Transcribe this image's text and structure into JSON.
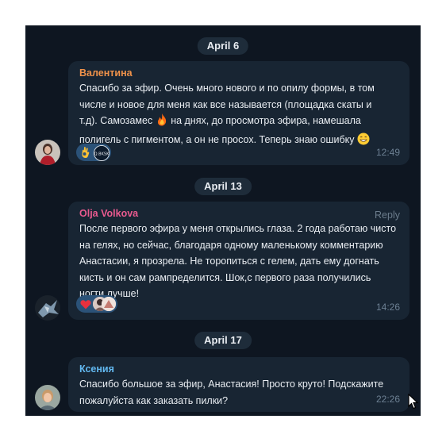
{
  "dates": [
    "April 6",
    "April 13",
    "April 17"
  ],
  "messages": [
    {
      "author": "Валентина",
      "author_color": "#f0924a",
      "text_lines": [
        "Спасибо за эфир. Очень много нового и по опилу формы, в том",
        "числе и новое для меня как все называется (площадка скаты и",
        "т.д). Самозамес",
        "на днях, до просмотра эфира, намешала",
        "полигель с пигментом, а он не просох. Теперь знаю ошибку"
      ],
      "inline_emojis": [
        "fire-emoji",
        "grinning-emoji"
      ],
      "reactions": [
        "ok-hand-emoji",
        "reactor-avatar"
      ],
      "time": "12:49"
    },
    {
      "author": "Olja Volkova",
      "author_color": "#e95a8f",
      "reply_label": "Reply",
      "text": "После первого эфира у меня открылись глаза. 2 года работаю чисто на гелях, но сейчас, благодаря одному маленькому комментарию Анастасии, я прозрела. Не торопиться с гелем, дать ему догнать кисть и он сам рампределится. Шок,с первого раза получились ногти лучше!",
      "reactions": [
        "heart-emoji",
        "reactor-avatar-1",
        "reactor-avatar-2"
      ],
      "time": "14:26"
    },
    {
      "author": "Ксения",
      "author_color": "#62b8f0",
      "text": "Спасибо большое за эфир, Анастасия! Просто круто! Подскажите пожалуйста как заказать пилки?",
      "time": "22:26"
    }
  ],
  "colors": {
    "background": "#0e1621",
    "bubble": "#182533",
    "date_pill": "#1e2c3a",
    "reaction_chip": "#2b5278",
    "text": "#e9edf2",
    "meta": "#6d8093"
  }
}
